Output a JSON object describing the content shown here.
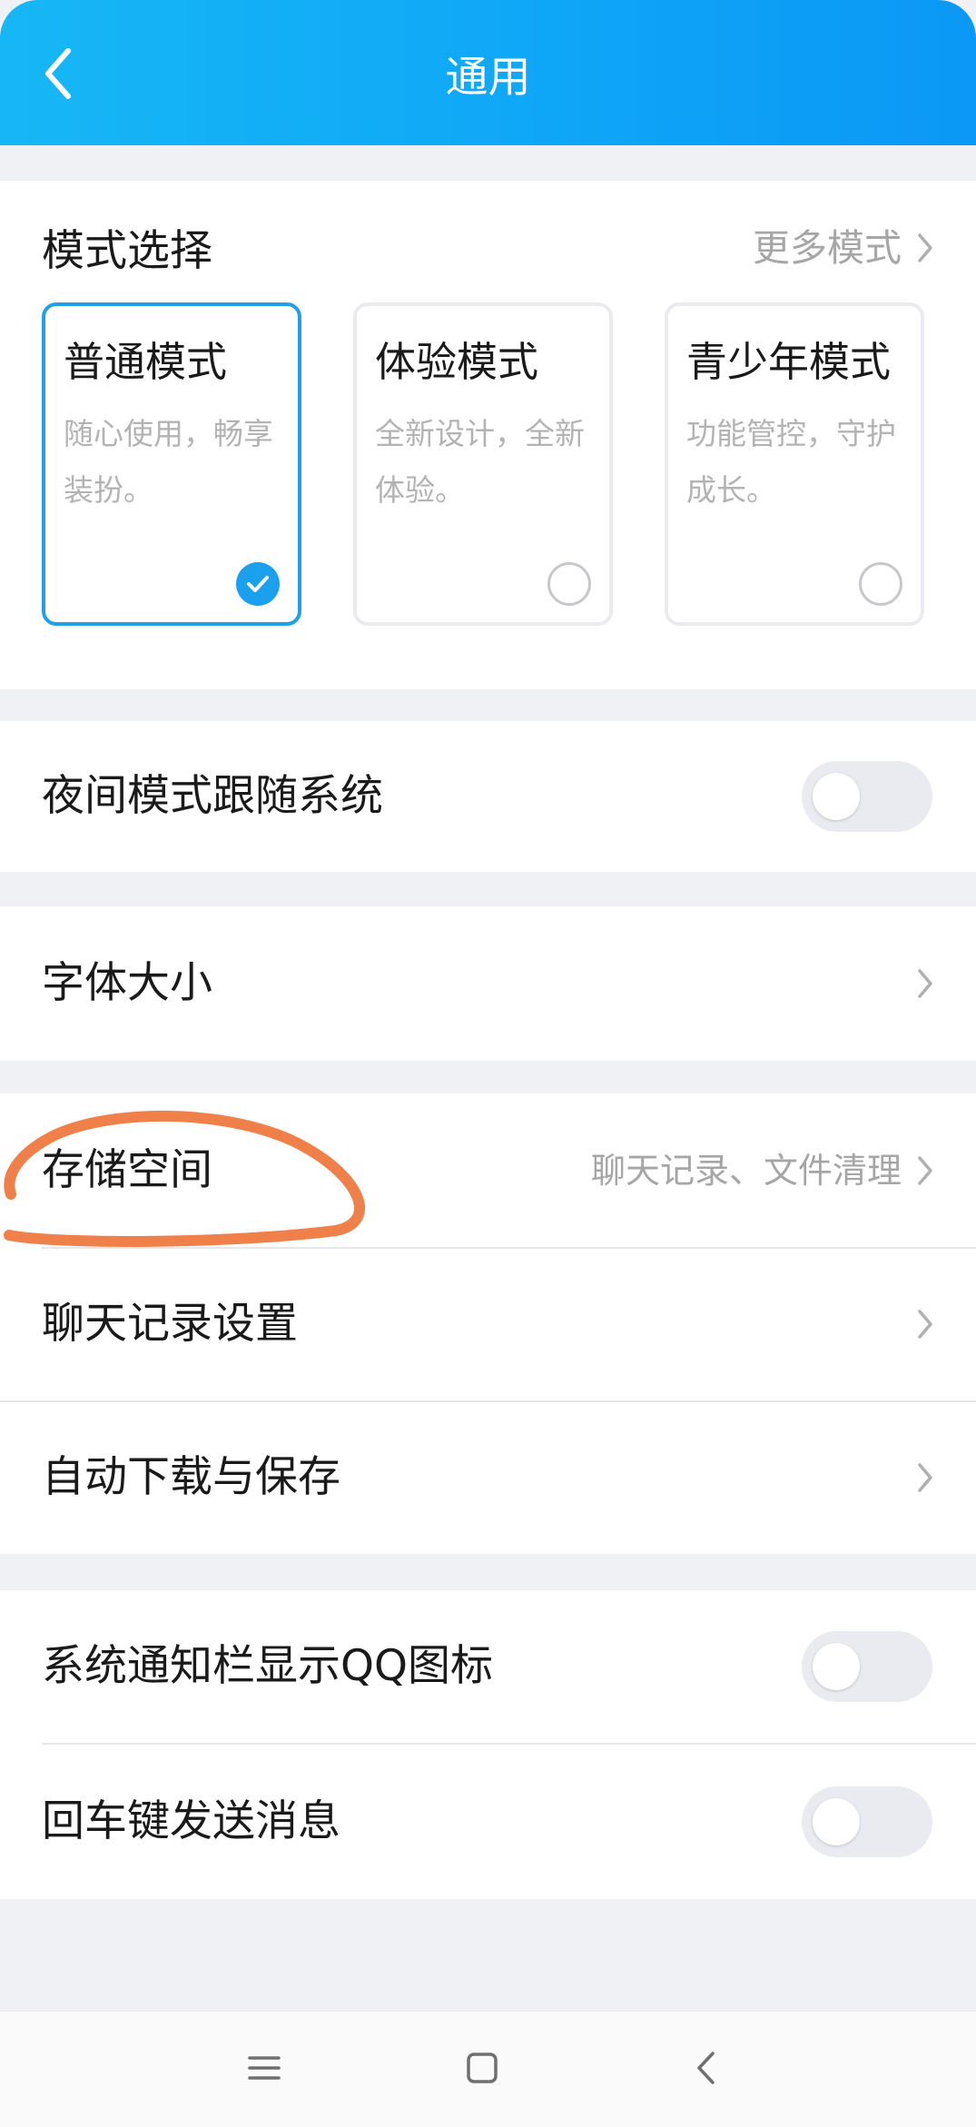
{
  "header": {
    "title": "通用",
    "back_icon": "chevron-left-icon"
  },
  "mode_section": {
    "label": "模式选择",
    "more_label": "更多模式",
    "modes": [
      {
        "title": "普通模式",
        "desc": "随心使用，畅享装扮。",
        "selected": true
      },
      {
        "title": "体验模式",
        "desc": "全新设计，全新体验。",
        "selected": false
      },
      {
        "title": "青少年模式",
        "desc": "功能管控，守护成长。",
        "selected": false
      }
    ]
  },
  "night_mode": {
    "label": "夜间模式跟随系统",
    "enabled": false
  },
  "font_size": {
    "label": "字体大小"
  },
  "storage_group": {
    "storage": {
      "label": "存储空间",
      "sub": "聊天记录、文件清理"
    },
    "chat_history": {
      "label": "聊天记录设置"
    },
    "auto_download": {
      "label": "自动下载与保存"
    }
  },
  "notify_group": {
    "notify_icon": {
      "label": "系统通知栏显示QQ图标",
      "enabled": false
    },
    "enter_send": {
      "label": "回车键发送消息",
      "enabled": false
    }
  },
  "nav_bar": {
    "icons": [
      "menu-icon",
      "home-square-icon",
      "back-triangle-icon"
    ]
  },
  "colors": {
    "header_start": "#17b7f5",
    "header_end": "#0b98f6",
    "accent": "#1ba0ee",
    "annotation": "#f0804a",
    "background": "#eff1f5"
  }
}
